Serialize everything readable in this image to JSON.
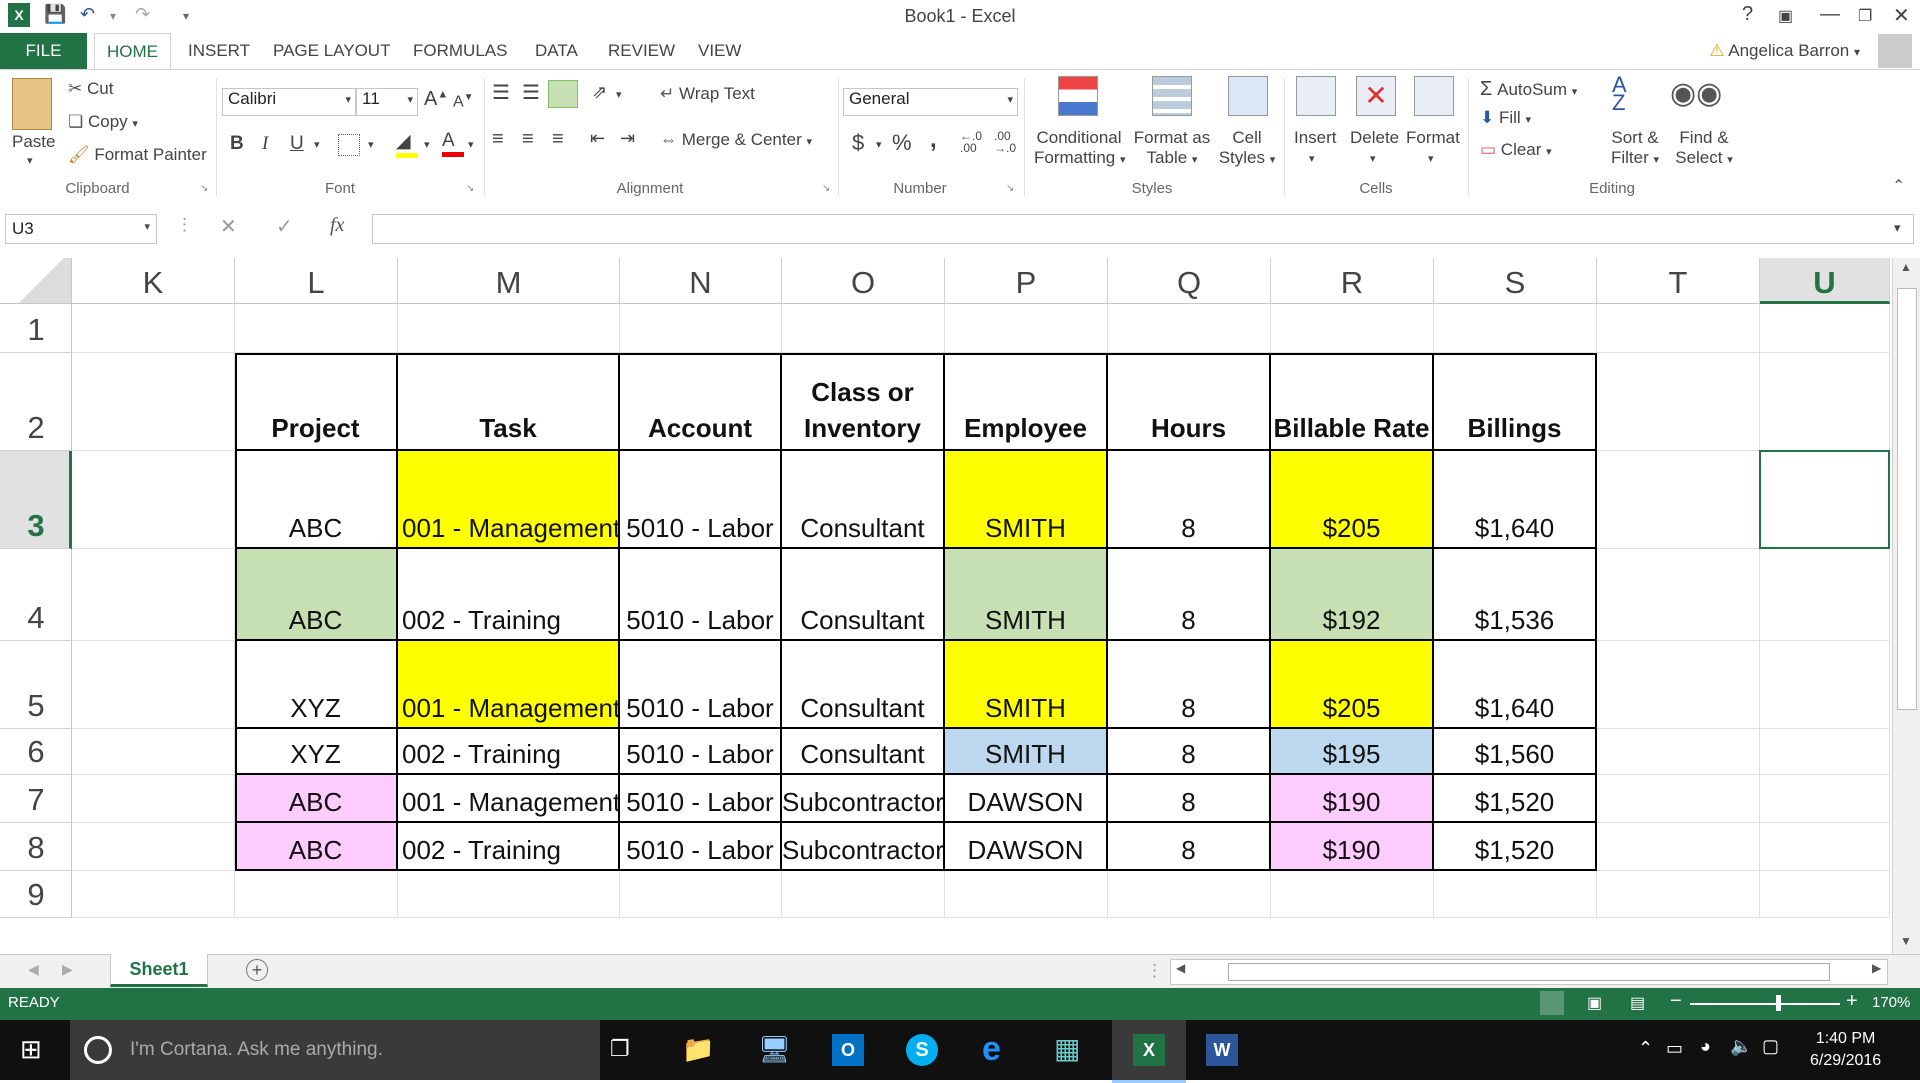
{
  "window": {
    "title": "Book1 - Excel"
  },
  "user": {
    "name": "Angelica Barron"
  },
  "tabs": {
    "file": "FILE",
    "items": [
      "HOME",
      "INSERT",
      "PAGE LAYOUT",
      "FORMULAS",
      "DATA",
      "REVIEW",
      "VIEW"
    ],
    "active": "HOME"
  },
  "ribbon": {
    "clipboard": {
      "label": "Clipboard",
      "paste": "Paste",
      "cut": "Cut",
      "copy": "Copy",
      "format_painter": "Format Painter"
    },
    "font": {
      "label": "Font",
      "name": "Calibri",
      "size": "11",
      "bold": "B",
      "italic": "I",
      "underline": "U"
    },
    "alignment": {
      "label": "Alignment",
      "wrap": "Wrap Text",
      "merge": "Merge & Center"
    },
    "number": {
      "label": "Number",
      "format": "General",
      "currency": "$",
      "percent": "%",
      "comma": ","
    },
    "styles": {
      "label": "Styles",
      "conditional": [
        "Conditional",
        "Formatting"
      ],
      "format_table": [
        "Format as",
        "Table"
      ],
      "cell_styles": [
        "Cell",
        "Styles"
      ]
    },
    "cells": {
      "label": "Cells",
      "insert": "Insert",
      "delete": "Delete",
      "format": "Format"
    },
    "editing": {
      "label": "Editing",
      "autosum": "AutoSum",
      "fill": "Fill",
      "clear": "Clear",
      "sort": [
        "Sort &",
        "Filter"
      ],
      "find": [
        "Find &",
        "Select"
      ]
    }
  },
  "formula_bar": {
    "name_box": "U3",
    "fx": "fx",
    "value": ""
  },
  "columns": [
    "K",
    "L",
    "M",
    "N",
    "O",
    "P",
    "Q",
    "R",
    "S",
    "T",
    "U"
  ],
  "rows": [
    "1",
    "2",
    "3",
    "4",
    "5",
    "6",
    "7",
    "8",
    "9"
  ],
  "table": {
    "headers": [
      "Project",
      "Task",
      "Account",
      "Class or|Inventory",
      "Employee",
      "Hours",
      "Billable Rate",
      "Billings"
    ],
    "rows": [
      [
        "ABC",
        "001 - Management",
        "5010 - Labor",
        "Consultant",
        "SMITH",
        "8",
        "$205",
        "$1,640"
      ],
      [
        "ABC",
        "002 - Training",
        "5010 - Labor",
        "Consultant",
        "SMITH",
        "8",
        "$192",
        "$1,536"
      ],
      [
        "XYZ",
        "001 - Management",
        "5010 - Labor",
        "Consultant",
        "SMITH",
        "8",
        "$205",
        "$1,640"
      ],
      [
        "XYZ",
        "002 - Training",
        "5010 - Labor",
        "Consultant",
        "SMITH",
        "8",
        "$195",
        "$1,560"
      ],
      [
        "ABC",
        "001 - Management",
        "5010 - Labor",
        "Subcontractor",
        "DAWSON",
        "8",
        "$190",
        "$1,520"
      ],
      [
        "ABC",
        "002 - Training",
        "5010 - Labor",
        "Subcontractor",
        "DAWSON",
        "8",
        "$190",
        "$1,520"
      ]
    ],
    "fills": [
      [
        "",
        "#ffff00",
        "",
        "",
        "#ffff00",
        "",
        "#ffff00",
        ""
      ],
      [
        "#c6e0b4",
        "",
        "",
        "",
        "#c6e0b4",
        "",
        "#c6e0b4",
        ""
      ],
      [
        "",
        "#ffff00",
        "",
        "",
        "#ffff00",
        "",
        "#ffff00",
        ""
      ],
      [
        "",
        "",
        "",
        "",
        "#bdd7ee",
        "",
        "#bdd7ee",
        ""
      ],
      [
        "#ffccff",
        "",
        "",
        "",
        "",
        "",
        "#ffccff",
        ""
      ],
      [
        "#ffccff",
        "",
        "",
        "",
        "",
        "",
        "#ffccff",
        ""
      ]
    ]
  },
  "sheets": {
    "active": "Sheet1"
  },
  "status": {
    "mode": "READY",
    "zoom": "170%"
  },
  "taskbar": {
    "search_placeholder": "I'm Cortana. Ask me anything.",
    "time": "1:40 PM",
    "date": "6/29/2016"
  },
  "colors": {
    "excel_green": "#217346",
    "selection": "#217346"
  }
}
